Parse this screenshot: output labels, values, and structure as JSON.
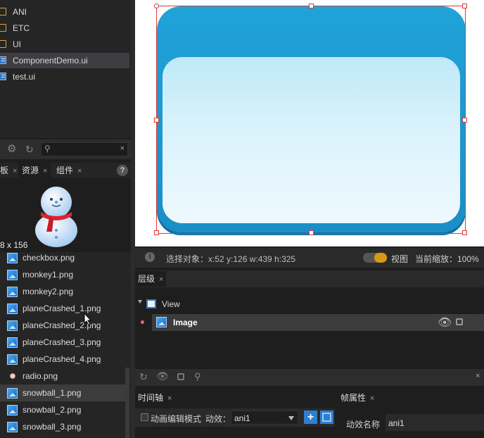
{
  "tree": {
    "items": [
      {
        "label": "ANI",
        "type": "folder"
      },
      {
        "label": "ETC",
        "type": "folder"
      },
      {
        "label": "UI",
        "type": "folder"
      },
      {
        "label": "ComponentDemo.ui",
        "type": "ui"
      },
      {
        "label": "test.ui",
        "type": "ui"
      }
    ]
  },
  "left_toolbar": {
    "search_clear": "×"
  },
  "left_tabs": {
    "tab1": "板",
    "tab1_close": "×",
    "tab2": "资源",
    "tab2_close": "×",
    "tab3": "组件",
    "tab3_close": "×",
    "help": "?"
  },
  "preview": {
    "dims": "8 x 156"
  },
  "resources": {
    "items": [
      {
        "label": "checkbox.png",
        "icon": "image"
      },
      {
        "label": "monkey1.png",
        "icon": "image"
      },
      {
        "label": "monkey2.png",
        "icon": "image"
      },
      {
        "label": "planeCrashed_1.png",
        "icon": "image"
      },
      {
        "label": "planeCrashed_2.png",
        "icon": "image"
      },
      {
        "label": "planeCrashed_3.png",
        "icon": "image"
      },
      {
        "label": "planeCrashed_4.png",
        "icon": "image"
      },
      {
        "label": "radio.png",
        "icon": "radio"
      },
      {
        "label": "snowball_1.png",
        "icon": "image"
      },
      {
        "label": "snowball_2.png",
        "icon": "image"
      },
      {
        "label": "snowball_3.png",
        "icon": "image"
      }
    ]
  },
  "status": {
    "selection": "选择对象：x:52 y:126  w:439 h:325",
    "view_label": "视图",
    "zoom": "当前缩放：100%"
  },
  "layers": {
    "tab": "层级",
    "tab_close": "×",
    "root": "View",
    "child": "Image"
  },
  "bottom_toolbar": {
    "close": "×"
  },
  "timeline": {
    "tab": "时间轴",
    "tab_close": "×",
    "mode_label": "动画编辑模式",
    "anim_label": "动效：",
    "anim_value": "ani1"
  },
  "frame_props": {
    "tab": "帧属性",
    "tab_close": "×",
    "name_label": "动效名称",
    "name_value": "ani1"
  },
  "colors": {
    "accent": "#1fa3d8",
    "selection_handle": "#e03b3b",
    "toggle": "#d79a16"
  }
}
